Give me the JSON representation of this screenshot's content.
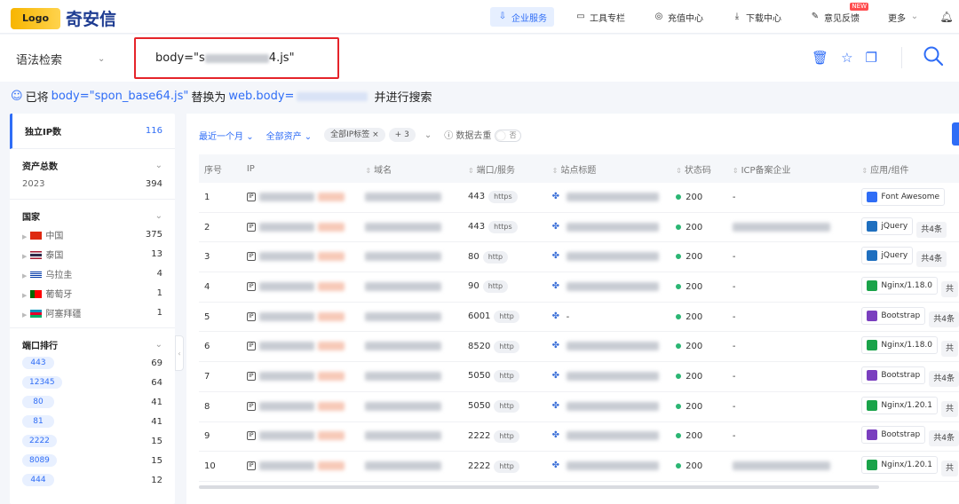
{
  "header": {
    "logo_text": "奇安信",
    "logo_mark": "Logo",
    "nav": [
      {
        "label": "企业服务",
        "icon": "enterprise-icon",
        "active": true
      },
      {
        "label": "工具专栏",
        "icon": "toolbox-icon"
      },
      {
        "label": "充值中心",
        "icon": "recharge-icon"
      },
      {
        "label": "下载中心",
        "icon": "download-icon"
      },
      {
        "label": "意见反馈",
        "icon": "feedback-icon",
        "badge": "NEW"
      },
      {
        "label": "更多",
        "icon": "chevron-down-icon"
      }
    ]
  },
  "search": {
    "syntax_label": "语法检索",
    "query_prefix": "body=\"s",
    "query_suffix": "4.js\""
  },
  "hint": {
    "p1": "已将",
    "p2": "body=\"spon_base64.js\"",
    "p3": "替换为",
    "p4": "web.body=",
    "p5": "并进行搜索"
  },
  "sidebar": {
    "unique_ip": {
      "label": "独立IP数",
      "value": "116"
    },
    "asset_total": {
      "label": "资产总数",
      "rows": [
        {
          "label": "2023",
          "count": "394"
        }
      ]
    },
    "country": {
      "label": "国家",
      "rows": [
        {
          "label": "中国",
          "count": "375",
          "flag": "cn"
        },
        {
          "label": "泰国",
          "count": "13",
          "flag": "th"
        },
        {
          "label": "乌拉圭",
          "count": "4",
          "flag": "uy"
        },
        {
          "label": "葡萄牙",
          "count": "1",
          "flag": "pt"
        },
        {
          "label": "阿塞拜疆",
          "count": "1",
          "flag": "az"
        }
      ]
    },
    "ports": {
      "label": "端口排行",
      "rows": [
        {
          "label": "443",
          "count": "69"
        },
        {
          "label": "12345",
          "count": "64"
        },
        {
          "label": "80",
          "count": "41"
        },
        {
          "label": "81",
          "count": "41"
        },
        {
          "label": "2222",
          "count": "15"
        },
        {
          "label": "8089",
          "count": "15"
        },
        {
          "label": "444",
          "count": "12"
        }
      ]
    }
  },
  "filters": {
    "time": "最近一个月",
    "assets": "全部资产",
    "tag": "全部IP标签",
    "tag_more": "+ 3",
    "dedupe": "数据去重",
    "toggle": "否"
  },
  "table": {
    "headers": [
      "序号",
      "IP",
      "域名",
      "端口/服务",
      "站点标题",
      "状态码",
      "ICP备案企业",
      "应用/组件"
    ],
    "rows": [
      {
        "no": "1",
        "port": "443",
        "svc": "https",
        "title": "",
        "status": "200",
        "icp": "-",
        "app": "Font Awesome",
        "app_color": "#2f6df6",
        "more": ""
      },
      {
        "no": "2",
        "port": "443",
        "svc": "https",
        "title": "",
        "status": "200",
        "icp": "",
        "app": "jQuery",
        "app_color": "#1f6fbf",
        "more": "共4条"
      },
      {
        "no": "3",
        "port": "80",
        "svc": "http",
        "title": "",
        "status": "200",
        "icp": "-",
        "app": "jQuery",
        "app_color": "#1f6fbf",
        "more": "共4条"
      },
      {
        "no": "4",
        "port": "90",
        "svc": "http",
        "title": "",
        "status": "200",
        "icp": "-",
        "app": "Nginx/1.18.0",
        "app_color": "#1aa34a",
        "more": "共"
      },
      {
        "no": "5",
        "port": "6001",
        "svc": "http",
        "title": "-",
        "status": "200",
        "icp": "-",
        "app": "Bootstrap",
        "app_color": "#7a3fbf",
        "more": "共4条"
      },
      {
        "no": "6",
        "port": "8520",
        "svc": "http",
        "title": "",
        "status": "200",
        "icp": "-",
        "app": "Nginx/1.18.0",
        "app_color": "#1aa34a",
        "more": "共"
      },
      {
        "no": "7",
        "port": "5050",
        "svc": "http",
        "title": "",
        "status": "200",
        "icp": "-",
        "app": "Bootstrap",
        "app_color": "#7a3fbf",
        "more": "共4条"
      },
      {
        "no": "8",
        "port": "5050",
        "svc": "http",
        "title": "",
        "status": "200",
        "icp": "-",
        "app": "Nginx/1.20.1",
        "app_color": "#1aa34a",
        "more": "共"
      },
      {
        "no": "9",
        "port": "2222",
        "svc": "http",
        "title": "",
        "status": "200",
        "icp": "-",
        "app": "Bootstrap",
        "app_color": "#7a3fbf",
        "more": "共4条"
      },
      {
        "no": "10",
        "port": "2222",
        "svc": "http",
        "title": "",
        "status": "200",
        "icp": "",
        "app": "Nginx/1.20.1",
        "app_color": "#1aa34a",
        "more": "共"
      }
    ]
  },
  "colors": {
    "accent": "#2f6df6",
    "highlight_box": "#e5242a",
    "status_ok": "#2bb673"
  }
}
